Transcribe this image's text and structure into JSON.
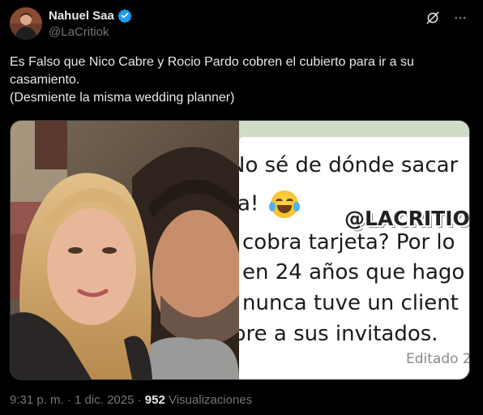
{
  "author": {
    "display_name": "Nahuel Saa",
    "handle": "@LaCritiok",
    "verified": true
  },
  "header_icons": [
    "grok-icon",
    "more-options-icon"
  ],
  "tweet": {
    "text_line1": "Es Falso que Nico Cabre y Rocio Pardo cobren el cubierto para ir a su",
    "text_line2": "casamiento.",
    "text_line3": "(Desmiente la misma wedding planner)"
  },
  "media": {
    "chat": {
      "line1": "No sé de dónde sacar",
      "line2": "a! ",
      "watermark": "@LACRITIOK",
      "line3": "cobra tarjeta? Por lo",
      "line4": "en 24 años que hago",
      "line5": "nunca tuve un client",
      "line6": "bre a sus invitados.",
      "edited": "Editado 2"
    }
  },
  "footer": {
    "time": "9:31 p. m.",
    "separator": " · ",
    "date": "1 dic. 2025",
    "views_count": "952",
    "views_label": "Visualizaciones"
  },
  "colors": {
    "background": "#000000",
    "text": "#e7e9ea",
    "secondary_text": "#71767b",
    "verified_blue": "#1d9bf0"
  }
}
